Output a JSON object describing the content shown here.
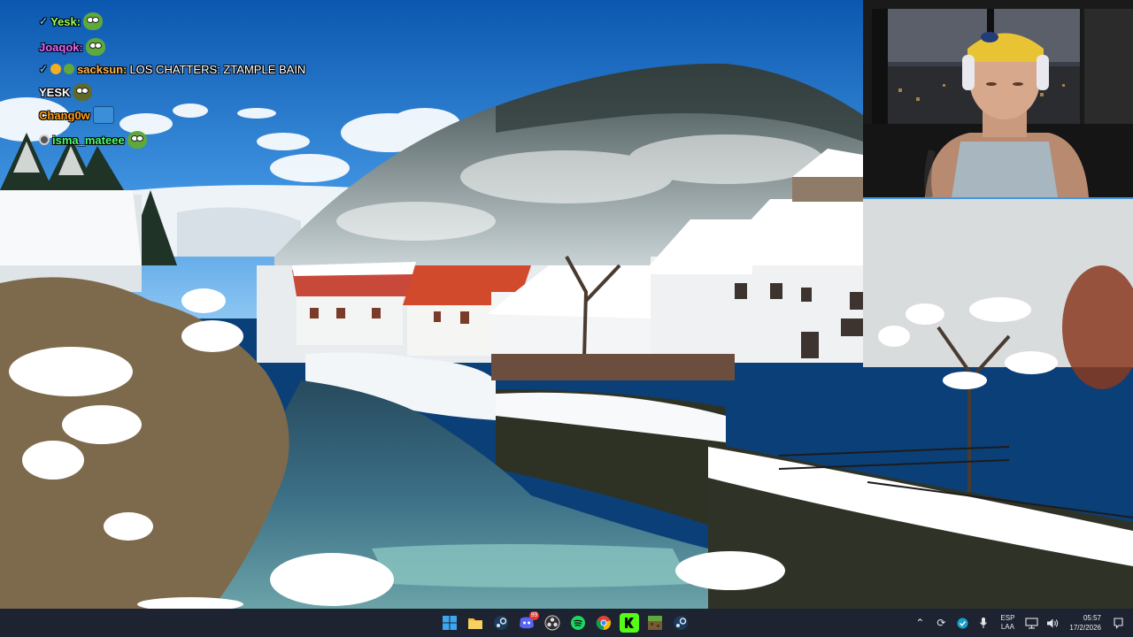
{
  "chat": {
    "lines": [
      {
        "user": "Yesk:",
        "color": "#9cff5a",
        "message": "",
        "badges": [
          "check"
        ],
        "emotes": [
          "frog"
        ]
      },
      {
        "user": "Joaqok:",
        "color": "#e267ff",
        "message": "",
        "badges": [],
        "emotes": [
          "frog"
        ]
      },
      {
        "user": "sacksun:",
        "color": "#ffb347",
        "message": "LOS CHATTERS: ZTAMPLE BAIN",
        "badges": [
          "check",
          "orange",
          "green"
        ],
        "emotes": []
      },
      {
        "user": "YESK",
        "color": "#ffffff",
        "message": "",
        "badges": [],
        "emotes": [
          "frog"
        ]
      },
      {
        "user": "Chang0w",
        "color": "#ff9f1a",
        "message": "",
        "badges": [],
        "emotes": [
          "box"
        ]
      },
      {
        "user": "isma_mateee",
        "color": "#4dff70",
        "message": "",
        "badges": [
          "ring"
        ],
        "emotes": [
          "frog"
        ]
      }
    ]
  },
  "taskbar": {
    "apps": [
      {
        "name": "start-icon"
      },
      {
        "name": "file-explorer-icon"
      },
      {
        "name": "steam-icon"
      },
      {
        "name": "discord-icon",
        "badge": "99"
      },
      {
        "name": "obs-icon"
      },
      {
        "name": "spotify-icon"
      },
      {
        "name": "chrome-icon"
      },
      {
        "name": "kick-icon"
      },
      {
        "name": "minecraft-icon"
      },
      {
        "name": "steam-icon-2"
      }
    ],
    "tray": {
      "lang_top": "ESP",
      "lang_bottom": "LAA",
      "time": "05:57",
      "date": "17/2/2026"
    }
  },
  "colors": {
    "taskbar": "#1d2330",
    "sky_top": "#0f5fb8",
    "sky_bottom": "#58a8e8",
    "river": "#2e5f78"
  }
}
